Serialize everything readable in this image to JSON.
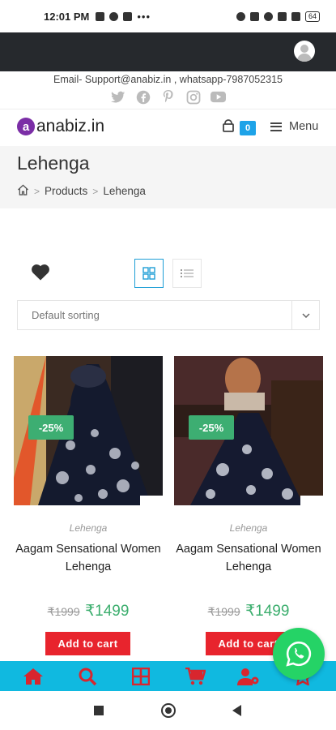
{
  "status_bar": {
    "time": "12:01 PM",
    "battery": "64"
  },
  "contact": {
    "text": "Email- Support@anabiz.in , whatsapp-7987052315"
  },
  "socials": [
    "twitter-icon",
    "facebook-icon",
    "pinterest-icon",
    "instagram-icon",
    "youtube-icon"
  ],
  "header": {
    "logo_mark": "a",
    "logo_text": "anabiz.in",
    "cart_count": "0",
    "menu_label": "Menu"
  },
  "page": {
    "title": "Lehenga",
    "breadcrumb": [
      "Products",
      "Lehenga"
    ]
  },
  "sorting": {
    "selected": "Default sorting"
  },
  "products": [
    {
      "category": "Lehenga",
      "name": "Aagam Sensational Women Lehenga",
      "sale_badge": "-25%",
      "old_price": "₹1999",
      "new_price": "₹1499",
      "button": "Add to cart"
    },
    {
      "category": "Lehenga",
      "name": "Aagam Sensational Women Lehenga",
      "sale_badge": "-25%",
      "old_price": "₹1999",
      "new_price": "₹1499",
      "button": "Add to cart"
    }
  ],
  "bottom_nav": [
    "home-icon",
    "search-icon",
    "categories-icon",
    "cart-icon",
    "account-settings-icon",
    "favorites-icon"
  ],
  "colors": {
    "accent": "#1ea3e8",
    "sale": "#3dae72",
    "button": "#e8242d",
    "bottom_nav": "#10b9e0",
    "whatsapp": "#25d366",
    "topbar": "#26292d"
  }
}
